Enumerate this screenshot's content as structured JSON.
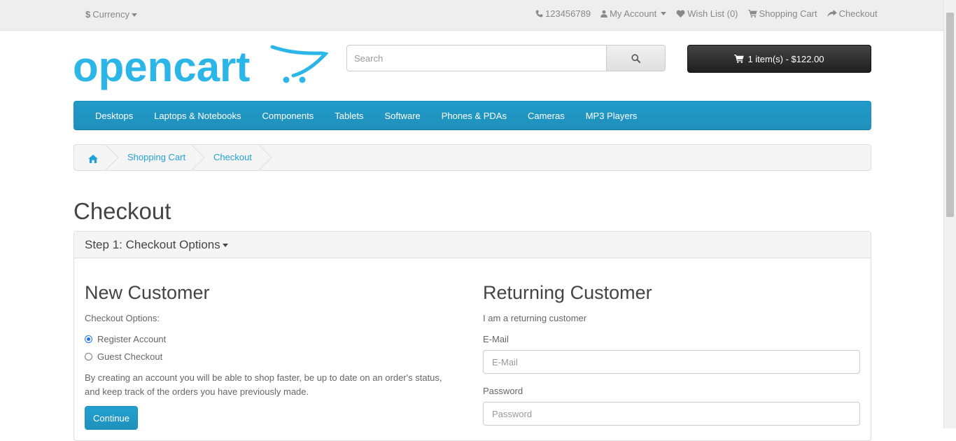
{
  "topbar": {
    "currency_symbol": "$",
    "currency_label": "Currency",
    "phone": "123456789",
    "my_account": "My Account",
    "wish_list": "Wish List (0)",
    "shopping_cart": "Shopping Cart",
    "checkout": "Checkout"
  },
  "header": {
    "logo_text": "opencart",
    "search_placeholder": "Search",
    "cart_label": "1 item(s) - $122.00"
  },
  "menu": [
    "Desktops",
    "Laptops & Notebooks",
    "Components",
    "Tablets",
    "Software",
    "Phones & PDAs",
    "Cameras",
    "MP3 Players"
  ],
  "breadcrumb": [
    "Shopping Cart",
    "Checkout"
  ],
  "page": {
    "title": "Checkout",
    "step_title": "Step 1: Checkout Options"
  },
  "new_customer": {
    "heading": "New Customer",
    "options_label": "Checkout Options:",
    "options": [
      "Register Account",
      "Guest Checkout"
    ],
    "selected_option": "Register Account",
    "description": "By creating an account you will be able to shop faster, be up to date on an order's status, and keep track of the orders you have previously made.",
    "continue_label": "Continue"
  },
  "returning_customer": {
    "heading": "Returning Customer",
    "subtext": "I am a returning customer",
    "email_label": "E-Mail",
    "email_placeholder": "E-Mail",
    "password_label": "Password",
    "password_placeholder": "Password"
  },
  "colors": {
    "accent": "#229ac8",
    "link": "#23a1d1",
    "logo": "#2cb6e8"
  }
}
